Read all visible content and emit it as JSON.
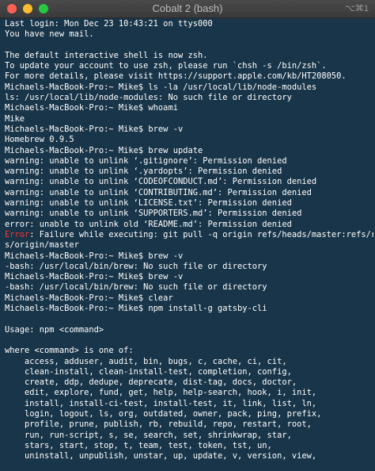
{
  "window": {
    "title": "Cobalt 2 (bash)",
    "shortcut": "⌥⌘1",
    "colors": {
      "background": "#193549",
      "text": "#ffffff",
      "error": "#ff3333"
    }
  },
  "terminal": {
    "lines": [
      {
        "text": "Last login: Mon Dec 23 10:43:21 on ttys000"
      },
      {
        "text": "You have new mail."
      },
      {
        "text": ""
      },
      {
        "text": "The default interactive shell is now zsh."
      },
      {
        "text": "To update your account to use zsh, please run `chsh -s /bin/zsh`."
      },
      {
        "text": "For more details, please visit https://support.apple.com/kb/HT208050."
      },
      {
        "text": "Michaels-MacBook-Pro:~ Mike$ ls -la /usr/local/lib/node-modules"
      },
      {
        "text": "ls: /usr/local/lib/node-modules: No such file or directory"
      },
      {
        "text": "Michaels-MacBook-Pro:~ Mike$ whoami"
      },
      {
        "text": "Mike"
      },
      {
        "text": "Michaels-MacBook-Pro:~ Mike$ brew -v"
      },
      {
        "text": "Homebrew 0.9.5"
      },
      {
        "text": "Michaels-MacBook-Pro:~ Mike$ brew update"
      },
      {
        "text": "warning: unable to unlink ‘.gitignore’: Permission denied"
      },
      {
        "text": "warning: unable to unlink ‘.yardopts’: Permission denied"
      },
      {
        "text": "warning: unable to unlink ‘CODEOFCONDUCT.md’: Permission denied"
      },
      {
        "text": "warning: unable to unlink ‘CONTRIBUTING.md’: Permission denied"
      },
      {
        "text": "warning: unable to unlink ‘LICENSE.txt’: Permission denied"
      },
      {
        "text": "warning: unable to unlink ‘SUPPORTERS.md’: Permission denied"
      },
      {
        "text": "error: unable to unlink old ‘README.md’: Permission denied"
      },
      {
        "prefix": "Error",
        "text": ": Failure while executing: git pull -q origin refs/heads/master:refs/remote"
      },
      {
        "text": "s/origin/master"
      },
      {
        "text": "Michaels-MacBook-Pro:~ Mike$ brew -v"
      },
      {
        "text": "-bash: /usr/local/bin/brew: No such file or directory"
      },
      {
        "text": "Michaels-MacBook-Pro:~ Mike$ brew -v"
      },
      {
        "text": "-bash: /usr/local/bin/brew: No such file or directory"
      },
      {
        "text": "Michaels-MacBook-Pro:~ Mike$ clear"
      },
      {
        "text": "Michaels-MacBook-Pro:~ Mike$ npm install-g gatsby-cli"
      },
      {
        "text": ""
      },
      {
        "text": "Usage: npm <command>"
      },
      {
        "text": ""
      },
      {
        "text": "where <command> is one of:"
      },
      {
        "text": "    access, adduser, audit, bin, bugs, c, cache, ci, cit,"
      },
      {
        "text": "    clean-install, clean-install-test, completion, config,"
      },
      {
        "text": "    create, ddp, dedupe, deprecate, dist-tag, docs, doctor,"
      },
      {
        "text": "    edit, explore, fund, get, help, help-search, hook, i, init,"
      },
      {
        "text": "    install, install-ci-test, install-test, it, link, list, ln,"
      },
      {
        "text": "    login, logout, ls, org, outdated, owner, pack, ping, prefix,"
      },
      {
        "text": "    profile, prune, publish, rb, rebuild, repo, restart, root,"
      },
      {
        "text": "    run, run-script, s, se, search, set, shrinkwrap, star,"
      },
      {
        "text": "    stars, start, stop, t, team, test, token, tst, un,"
      },
      {
        "text": "    uninstall, unpublish, unstar, up, update, v, version, view,"
      }
    ]
  }
}
